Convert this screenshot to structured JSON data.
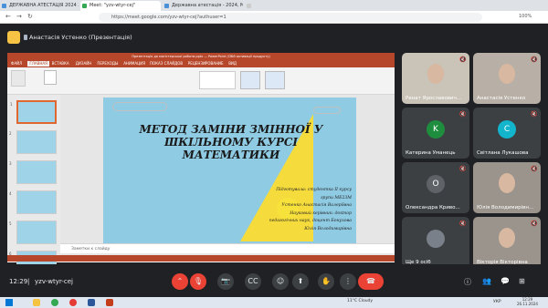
{
  "browser": {
    "tabs": [
      {
        "label": "ДЕРЖАВНА АТЕСТАЦІЯ 2024 ЖУ",
        "color": "#4a90d9"
      },
      {
        "label": "Meet: \"yzv-wtyr-cej\"\nвисталятується",
        "color": "#34a853"
      },
      {
        "label": "Державна атестація - 2024, МЕ",
        "color": "#4a90d9"
      },
      {
        "label": "",
        "color": "#cccccc"
      }
    ],
    "url": "https://meet.google.com/yzv-wtyr-cej?authuser=1",
    "zoom": "100%"
  },
  "meet": {
    "presenter_label": "Анастасія Устенко (Презентація)",
    "meeting_time": "12:29",
    "meeting_code": "yzv-wtyr-cej",
    "participants": [
      {
        "name": "Ренат Ярославович...",
        "type": "video"
      },
      {
        "name": "Анастасія Устенко",
        "type": "video"
      },
      {
        "name": "Катерина Уманець",
        "initial": "K",
        "color": "#1e8e3e"
      },
      {
        "name": "Світлана Лукашова",
        "initial": "С",
        "color": "#12b5cb"
      },
      {
        "name": "Олександра Криво...",
        "initial": "О",
        "color": "#5f6368"
      },
      {
        "name": "Юлія Володимирівн...",
        "type": "video"
      },
      {
        "name": "Ще 9 осіб",
        "initial": "",
        "color": "#5f6368"
      },
      {
        "name": "Вікторія Вікторівна",
        "type": "video"
      }
    ],
    "controls": [
      "chevron-up",
      "mic-off",
      "camera-off",
      "captions",
      "emoji",
      "present",
      "hand",
      "more",
      "leave"
    ]
  },
  "powerpoint": {
    "title": "Презентація до магістерської роботи.pptx — PowerPoint (Сбій активації продукту)",
    "tabs": [
      "ФАЙЛ",
      "ГЛАВНАЯ",
      "ВСТАВКА",
      "ДИЗАЙН",
      "ПЕРЕХОДЫ",
      "АНИМАЦИЯ",
      "ПОКАЗ СЛАЙДОВ",
      "РЕЦЕНЗИРОВАНИЕ",
      "ВИД"
    ],
    "notes_placeholder": "Заметки к слайду",
    "slide_count": 6
  },
  "slide": {
    "title": "МЕТОД ЗАМІНИ ЗМІННОЇ У ШКІЛЬНОМУ КУРСІ МАТЕМАТИКИ",
    "details": [
      "Підготувала: студентка II курсу",
      "групи МЕ23М",
      "Устенко Анастасія Валеріївна",
      "Науковий керівник: доктор",
      "педагогічних наук, доцент Бонухова",
      "Юлія Володимирівна"
    ]
  },
  "taskbar": {
    "weather": "11°C Cloudy",
    "lang": "УКР",
    "time": "12:29",
    "date": "26.11.2024"
  }
}
